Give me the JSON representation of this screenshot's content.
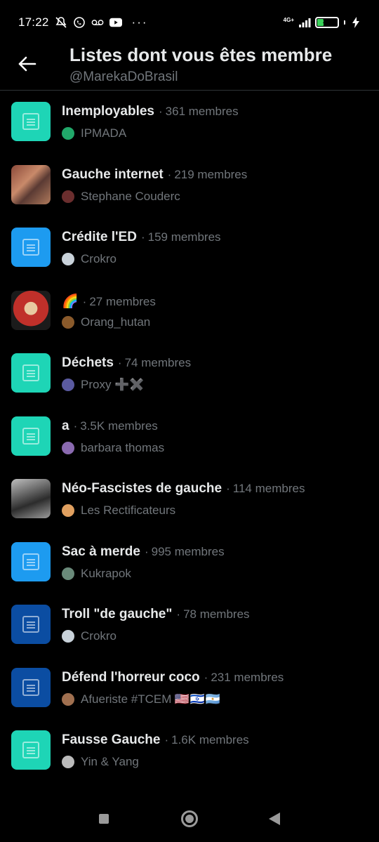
{
  "status_bar": {
    "time": "17:22",
    "network": "4G+",
    "battery": "31",
    "more": "···"
  },
  "header": {
    "title": "Listes dont vous êtes membre",
    "subtitle": "@MarekaDoBrasil"
  },
  "lists": [
    {
      "name": "Inemployables",
      "count": "361 membres",
      "owner": "IPMADA",
      "thumb": "default",
      "color": "#1ed5b6",
      "avatar_color": "#21a86a"
    },
    {
      "name": "Gauche internet",
      "count": "219 membres",
      "owner": "Stephane Couderc",
      "thumb": "photo-1",
      "color": "#8b4a3a",
      "avatar_color": "#6b2e2e"
    },
    {
      "name": "Crédite l'ED",
      "count": "159 membres",
      "owner": "Crokro",
      "thumb": "default",
      "color": "#1d9bf0",
      "avatar_color": "#c9d2da"
    },
    {
      "name": "🌈",
      "count": "27 membres",
      "owner": "Orang_hutan",
      "thumb": "photo-2",
      "color": "#c0302a",
      "avatar_color": "#8a5a2b"
    },
    {
      "name": "Déchets",
      "count": "74 membres",
      "owner": "Proxy ➕✖️",
      "thumb": "default",
      "color": "#1ed5b6",
      "avatar_color": "#5a5aa0"
    },
    {
      "name": "a",
      "count": "3.5K membres",
      "owner": "barbara thomas",
      "thumb": "default",
      "color": "#1ed5b6",
      "avatar_color": "#8a6ab0"
    },
    {
      "name": "Néo-Fascistes de gauche",
      "count": "114 membres",
      "owner": "Les Rectificateurs",
      "thumb": "photo-3",
      "color": "#555555",
      "avatar_color": "#e0a060"
    },
    {
      "name": "Sac à merde",
      "count": "995 membres",
      "owner": "Kukrapok",
      "thumb": "default",
      "color": "#1d9bf0",
      "avatar_color": "#6a8a7a"
    },
    {
      "name": "Troll \"de gauche\"",
      "count": "78 membres",
      "owner": "Crokro",
      "thumb": "default",
      "color": "#0b4da2",
      "avatar_color": "#c9d2da"
    },
    {
      "name": "Défend l'horreur coco",
      "count": "231 membres",
      "owner": "Afueriste #TCEM",
      "flags": "🇺🇸🇮🇱🇦🇷",
      "thumb": "default",
      "color": "#0b4da2",
      "avatar_color": "#a07050"
    },
    {
      "name": "Fausse Gauche",
      "count": "1.6K membres",
      "owner": "Yin & Yang",
      "thumb": "default",
      "color": "#1ed5b6",
      "avatar_color": "#bbbbbb"
    }
  ],
  "icons": {
    "back": "arrow-left-icon",
    "list": "list-icon"
  }
}
